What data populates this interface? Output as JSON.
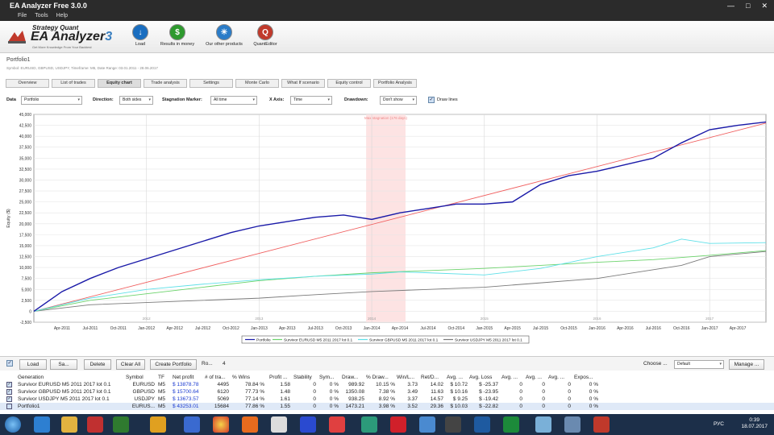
{
  "window": {
    "title": "EA Analyzer Free 3.0.0",
    "min": "—",
    "max": "□",
    "close": "✕"
  },
  "menu": [
    "File",
    "Tools",
    "Help"
  ],
  "logo": {
    "top": "Strategy Quant",
    "main": "EA Analyzer",
    "version": "3",
    "sub": "Get More Knowledge From Your Backtest"
  },
  "toolbar": [
    {
      "label": "Load",
      "icon": "download-icon",
      "color": "#1a6ec0"
    },
    {
      "label": "Results in money",
      "icon": "dollar-icon",
      "color": "#2e9a2e"
    },
    {
      "label": "Our other products",
      "icon": "lightbulb-icon",
      "color": "#2a7cc8"
    },
    {
      "label": "QuantEditor",
      "icon": "quanteditor-icon",
      "color": "#c0392b"
    }
  ],
  "portfolio": {
    "title": "Portfolio1",
    "subtitle": "Symbol: EURUSD, GBPUSD, USDJPY, Timeframe: M5, Date Range: 03.01.2011 - 28.06.2017"
  },
  "tabs": [
    "Overview",
    "List of trades",
    "Equity chart",
    "Trade analysis",
    "Settings",
    "Monte Carlo",
    "What If scenario",
    "Equity control",
    "Portfolio Analysis"
  ],
  "active_tab": "Equity chart",
  "filters": {
    "data_label": "Data",
    "data_value": "Portfolio",
    "direction_label": "Direction:",
    "direction_value": "Both sides",
    "stagnation_label": "Stagnation Marker:",
    "stagnation_value": "All time",
    "xaxis_label": "X Axis:",
    "xaxis_value": "Time",
    "drawdown_label": "Drawdown:",
    "drawdown_value": "Don't show",
    "drawlines_label": "Draw lines",
    "drawlines_checked": "✓"
  },
  "chart_data": {
    "type": "line",
    "ylabel": "Equity ($)",
    "ylim": [
      -2500,
      45000
    ],
    "yticks": [
      "-2,500",
      "0",
      "2,500",
      "5,000",
      "7,500",
      "10,000",
      "12,500",
      "15,000",
      "17,500",
      "20,000",
      "22,500",
      "25,000",
      "27,500",
      "30,000",
      "32,500",
      "35,000",
      "37,500",
      "40,000",
      "42,500",
      "45,000"
    ],
    "xticks": [
      "Apr-2011",
      "Jul-2011",
      "Oct-2011",
      "Jan-2012",
      "Apr-2012",
      "Jul-2012",
      "Oct-2012",
      "Jan-2013",
      "Apr-2013",
      "Jul-2013",
      "Oct-2013",
      "Jan-2014",
      "Apr-2014",
      "Jul-2014",
      "Oct-2014",
      "Jan-2015",
      "Apr-2015",
      "Jul-2015",
      "Oct-2015",
      "Jan-2016",
      "Apr-2016",
      "Jul-2016",
      "Oct-2016",
      "Jan-2017",
      "Apr-2017"
    ],
    "x_range": [
      2011.0,
      2017.5
    ],
    "year_labels": [
      "2012",
      "2013",
      "2014",
      "2015",
      "2016",
      "2017"
    ],
    "stagnation_label": "Max stagnation (176 days)",
    "stagnation_range": [
      2013.95,
      2014.3
    ],
    "grid": true,
    "legend_placement": "bottom",
    "series": [
      {
        "name": "Portfolio",
        "color": "#1a1aa8",
        "x": [
          2011.0,
          2011.25,
          2011.5,
          2011.75,
          2012.0,
          2012.25,
          2012.5,
          2012.75,
          2013.0,
          2013.25,
          2013.5,
          2013.75,
          2014.0,
          2014.25,
          2014.5,
          2014.75,
          2015.0,
          2015.25,
          2015.5,
          2015.75,
          2016.0,
          2016.25,
          2016.5,
          2016.75,
          2017.0,
          2017.25,
          2017.5
        ],
        "values": [
          0,
          4500,
          7500,
          10000,
          12000,
          14000,
          16000,
          18000,
          19500,
          20500,
          21500,
          22000,
          21000,
          22500,
          23500,
          24500,
          24500,
          25000,
          29000,
          31000,
          32000,
          33500,
          35000,
          38500,
          41500,
          42500,
          43253
        ]
      },
      {
        "name": "Survivor EURUSD M5 2011 2017 lot 0.1",
        "color": "#6cd36c",
        "x": [
          2011.0,
          2011.5,
          2012.0,
          2012.5,
          2013.0,
          2013.5,
          2014.0,
          2014.5,
          2015.0,
          2015.5,
          2016.0,
          2016.5,
          2017.0,
          2017.5
        ],
        "values": [
          0,
          2500,
          4000,
          5500,
          7000,
          8000,
          8800,
          9300,
          9800,
          10500,
          11200,
          11800,
          12800,
          13879
        ]
      },
      {
        "name": "Survivor GBPUSD M5 2011 2017 lot 0.1",
        "color": "#5fe0e8",
        "x": [
          2011.0,
          2011.5,
          2012.0,
          2012.5,
          2013.0,
          2013.5,
          2014.0,
          2014.25,
          2014.5,
          2015.0,
          2015.5,
          2016.0,
          2016.5,
          2016.75,
          2017.0,
          2017.5
        ],
        "values": [
          0,
          3000,
          5000,
          6200,
          7200,
          8000,
          8500,
          9000,
          8800,
          8300,
          9800,
          12500,
          14500,
          16500,
          15500,
          15701
        ]
      },
      {
        "name": "Survivor USDJPY M5 2011 2017 lot 0.1",
        "color": "#7a7a7a",
        "x": [
          2011.0,
          2011.5,
          2012.0,
          2012.5,
          2013.0,
          2013.5,
          2014.0,
          2014.5,
          2015.0,
          2015.5,
          2016.0,
          2016.5,
          2016.75,
          2017.0,
          2017.5
        ],
        "values": [
          0,
          1500,
          2000,
          2500,
          3000,
          3800,
          4500,
          5000,
          5500,
          6500,
          7500,
          9500,
          10500,
          12500,
          13674
        ]
      },
      {
        "name": "Trend line",
        "color": "#f06060",
        "x": [
          2011.0,
          2017.5
        ],
        "values": [
          0,
          43000
        ]
      }
    ]
  },
  "bottom": {
    "load": "Load",
    "save": "Sa...",
    "delete": "Delete",
    "clear_all": "Clear All",
    "create_portfolio": "Create Portfolio",
    "rows_label": "Ro...",
    "rows_count": "4",
    "choose_label": "Choose ...",
    "choose_value": "Default",
    "manage": "Manage ..."
  },
  "table": {
    "headers": [
      "Generation",
      "Symbol",
      "TF",
      "Net profit",
      "# of tra...",
      "% Wins",
      "Profit ...",
      "Stability",
      "Sym...",
      "Draw...",
      "% Draw...",
      "Win/L...",
      "Ret/D...",
      "Avg. ...",
      "Avg. Loss",
      "Avg. ...",
      "Avg. ...",
      "Avg. ...",
      "Expos..."
    ],
    "rows": [
      [
        "Survivor EURUSD M5 2011 2017 lot 0.1",
        "EURUSD",
        "M5",
        "$ 13878.78",
        "4495",
        "78.84 %",
        "1.58",
        "0",
        "0 %",
        "989.92",
        "10.15 %",
        "3.73",
        "14.02",
        "$ 10.72",
        "$ -25.37",
        "0",
        "0",
        "0",
        "0 %"
      ],
      [
        "Survivor GBPUSD M5 2011 2017 lot 0.1",
        "GBPUSD",
        "M5",
        "$ 15700.64",
        "6120",
        "77.73 %",
        "1.48",
        "0",
        "0 %",
        "1350.08",
        "7.38 %",
        "3.49",
        "11.63",
        "$ 10.16",
        "$ -23.95",
        "0",
        "0",
        "0",
        "0 %"
      ],
      [
        "Survivor USDJPY M5 2011 2017 lot 0.1",
        "USDJPY",
        "M5",
        "$ 13673.57",
        "5069",
        "77.14 %",
        "1.61",
        "0",
        "0 %",
        "938.25",
        "8.92 %",
        "3.37",
        "14.57",
        "$ 9.25",
        "$ -19.42",
        "0",
        "0",
        "0",
        "0 %"
      ],
      [
        "Portfolio1",
        "EURUS...",
        "M5",
        "$ 43253.01",
        "15684",
        "77.86 %",
        "1.55",
        "0",
        "0 %",
        "1473.21",
        "3.98 %",
        "3.52",
        "29.36",
        "$ 10.03",
        "$ -22.82",
        "0",
        "0",
        "0",
        "0 %"
      ]
    ]
  },
  "taskbar": {
    "lang": "РУС",
    "time": "0:39",
    "date": "18.07.2017"
  }
}
